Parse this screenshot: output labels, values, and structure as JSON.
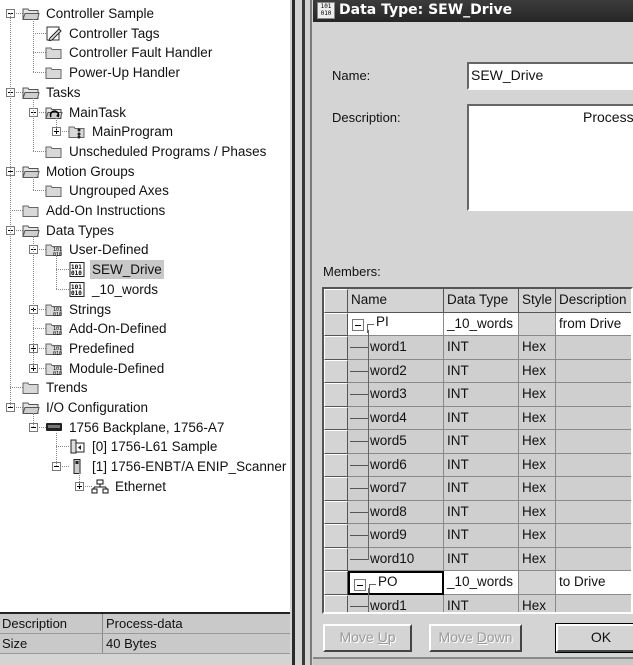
{
  "tree": {
    "items": [
      {
        "label": "Controller Sample",
        "depth": 0,
        "toggle": "minus",
        "icon": "folder-open-icon"
      },
      {
        "label": "Controller Tags",
        "depth": 1,
        "toggle": null,
        "icon": "tags-edit-icon"
      },
      {
        "label": "Controller Fault Handler",
        "depth": 1,
        "toggle": null,
        "icon": "folder-icon"
      },
      {
        "label": "Power-Up Handler",
        "depth": 1,
        "toggle": null,
        "icon": "folder-icon"
      },
      {
        "label": "Tasks",
        "depth": 0,
        "toggle": "minus",
        "icon": "folder-open-icon"
      },
      {
        "label": "MainTask",
        "depth": 1,
        "toggle": "minus",
        "icon": "task-cycle-icon"
      },
      {
        "label": "MainProgram",
        "depth": 2,
        "toggle": "plus",
        "icon": "program-folder-icon"
      },
      {
        "label": "Unscheduled Programs / Phases",
        "depth": 1,
        "toggle": null,
        "icon": "folder-icon"
      },
      {
        "label": "Motion Groups",
        "depth": 0,
        "toggle": "minus",
        "icon": "folder-open-icon"
      },
      {
        "label": "Ungrouped Axes",
        "depth": 1,
        "toggle": null,
        "icon": "folder-icon"
      },
      {
        "label": "Add-On Instructions",
        "depth": 0,
        "toggle": null,
        "icon": "folder-icon"
      },
      {
        "label": "Data Types",
        "depth": 0,
        "toggle": "minus",
        "icon": "folder-open-icon"
      },
      {
        "label": "User-Defined",
        "depth": 1,
        "toggle": "minus",
        "icon": "datatype-folder-icon"
      },
      {
        "label": "SEW_Drive",
        "depth": 2,
        "toggle": null,
        "icon": "datatype-icon",
        "selected": true
      },
      {
        "label": "_10_words",
        "depth": 2,
        "toggle": null,
        "icon": "datatype-icon"
      },
      {
        "label": "Strings",
        "depth": 1,
        "toggle": "plus",
        "icon": "datatype-folder-icon"
      },
      {
        "label": "Add-On-Defined",
        "depth": 1,
        "toggle": null,
        "icon": "datatype-folder-icon"
      },
      {
        "label": "Predefined",
        "depth": 1,
        "toggle": "plus",
        "icon": "datatype-folder-icon"
      },
      {
        "label": "Module-Defined",
        "depth": 1,
        "toggle": "plus",
        "icon": "datatype-folder-icon"
      },
      {
        "label": "Trends",
        "depth": 0,
        "toggle": null,
        "icon": "folder-icon"
      },
      {
        "label": "I/O Configuration",
        "depth": 0,
        "toggle": "minus",
        "icon": "folder-open-icon"
      },
      {
        "label": "1756 Backplane, 1756-A7",
        "depth": 1,
        "toggle": "minus",
        "icon": "backplane-icon"
      },
      {
        "label": "[0] 1756-L61 Sample",
        "depth": 2,
        "toggle": null,
        "icon": "controller-module-icon"
      },
      {
        "label": "[1] 1756-ENBT/A ENIP_Scanner",
        "depth": 2,
        "toggle": "minus",
        "icon": "ethernet-module-icon"
      },
      {
        "label": "Ethernet",
        "depth": 3,
        "toggle": "plus",
        "icon": "network-icon"
      }
    ]
  },
  "properties": [
    {
      "key": "Description",
      "value": "Process-data"
    },
    {
      "key": "Size",
      "value": "40 Bytes"
    }
  ],
  "dialog": {
    "title": "Data Type:  SEW_Drive",
    "title_icon_text": "101 010",
    "name_label": "Name:",
    "name_value": "SEW_Drive",
    "description_label": "Description:",
    "description_value": "Process-data",
    "members_label": "Members:",
    "columns": [
      "Name",
      "Data Type",
      "Style",
      "Description"
    ],
    "members": [
      {
        "name": "PI",
        "type": "_10_words",
        "style": "",
        "description": "from Drive",
        "parent": true
      },
      {
        "name": "word1",
        "type": "INT",
        "style": "Hex",
        "description": ""
      },
      {
        "name": "word2",
        "type": "INT",
        "style": "Hex",
        "description": ""
      },
      {
        "name": "word3",
        "type": "INT",
        "style": "Hex",
        "description": ""
      },
      {
        "name": "word4",
        "type": "INT",
        "style": "Hex",
        "description": ""
      },
      {
        "name": "word5",
        "type": "INT",
        "style": "Hex",
        "description": ""
      },
      {
        "name": "word6",
        "type": "INT",
        "style": "Hex",
        "description": ""
      },
      {
        "name": "word7",
        "type": "INT",
        "style": "Hex",
        "description": ""
      },
      {
        "name": "word8",
        "type": "INT",
        "style": "Hex",
        "description": ""
      },
      {
        "name": "word9",
        "type": "INT",
        "style": "Hex",
        "description": ""
      },
      {
        "name": "word10",
        "type": "INT",
        "style": "Hex",
        "description": ""
      },
      {
        "name": "PO",
        "type": "_10_words",
        "style": "",
        "description": "to Drive",
        "parent": true,
        "focused": true
      },
      {
        "name": "word1",
        "type": "INT",
        "style": "Hex",
        "description": ""
      }
    ],
    "buttons": {
      "move_up_prefix": "Move ",
      "move_up_key": "U",
      "move_up_suffix": "p",
      "move_down_prefix": "Move ",
      "move_down_key": "D",
      "move_down_suffix": "own",
      "ok": "OK"
    }
  }
}
